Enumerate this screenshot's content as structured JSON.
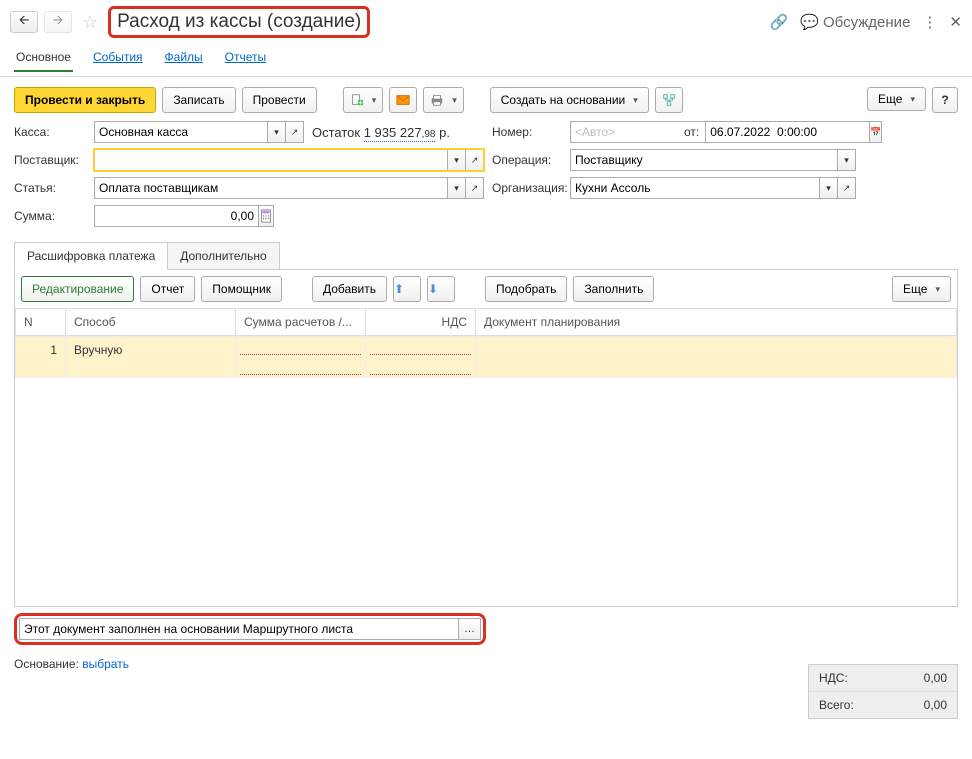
{
  "header": {
    "title": "Расход из кассы (создание)",
    "discuss": "Обсуждение"
  },
  "nav": {
    "main": "Основное",
    "events": "События",
    "files": "Файлы",
    "reports": "Отчеты"
  },
  "toolbar": {
    "post_close": "Провести и закрыть",
    "save": "Записать",
    "post": "Провести",
    "create_based": "Создать на основании",
    "more": "Еще",
    "help": "?"
  },
  "form": {
    "kassa_label": "Касса:",
    "kassa_value": "Основная касса",
    "balance_label": "Остаток",
    "balance_main": "1 935 227",
    "balance_dec": ",98",
    "balance_cur": "р.",
    "supplier_label": "Поставщик:",
    "supplier_value": "",
    "article_label": "Статья:",
    "article_value": "Оплата поставщикам",
    "sum_label": "Сумма:",
    "sum_value": "0,00",
    "number_label": "Номер:",
    "number_placeholder": "<Авто>",
    "from_label": "от:",
    "date_value": "06.07.2022  0:00:00",
    "operation_label": "Операция:",
    "operation_value": "Поставщику",
    "org_label": "Организация:",
    "org_value": "Кухни Ассоль"
  },
  "subtabs": {
    "breakdown": "Расшифровка платежа",
    "additional": "Дополнительно"
  },
  "table_tb": {
    "edit": "Редактирование",
    "report": "Отчет",
    "helper": "Помощник",
    "add": "Добавить",
    "pick": "Подобрать",
    "fill": "Заполнить",
    "more": "Еще"
  },
  "table": {
    "cols": {
      "n": "N",
      "method": "Способ",
      "sum": "Сумма расчетов /...",
      "vat": "НДС",
      "plan": "Документ планирования"
    },
    "rows": [
      {
        "n": "1",
        "method": "Вручную"
      }
    ]
  },
  "comment": "Этот документ заполнен на основании Маршрутного листа",
  "totals": {
    "vat_label": "НДС:",
    "vat_value": "0,00",
    "total_label": "Всего:",
    "total_value": "0,00"
  },
  "basis": {
    "label": "Основание:",
    "link": "выбрать"
  }
}
